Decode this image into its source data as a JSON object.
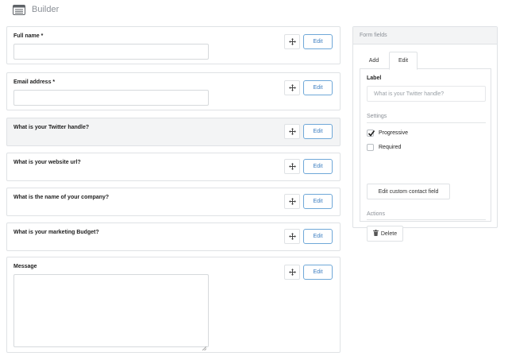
{
  "header": {
    "title": "Builder",
    "icon": "form-list-icon"
  },
  "fields": [
    {
      "label": "Full name *",
      "type": "input"
    },
    {
      "label": "Email address *",
      "type": "input"
    },
    {
      "label": "What is your Twitter handle?",
      "type": "none",
      "active": true
    },
    {
      "label": "What is your website url?",
      "type": "none"
    },
    {
      "label": "What is the name of your company?",
      "type": "none"
    },
    {
      "label": "What is your marketing Budget?",
      "type": "none"
    },
    {
      "label": "Message",
      "type": "textarea"
    }
  ],
  "field_actions": {
    "move_icon": "move-arrows-icon",
    "edit_label": "Edit"
  },
  "panel": {
    "title": "Form fields",
    "tabs": [
      {
        "label": "Add"
      },
      {
        "label": "Edit",
        "selected": true
      }
    ],
    "label_heading": "Label",
    "label_value": "What is your Twitter handle?",
    "settings_heading": "Settings",
    "progressive_label": "Progressive",
    "progressive_checked": true,
    "required_label": "Required",
    "required_checked": false,
    "custom_button": "Edit custom contact field",
    "actions_heading": "Actions",
    "delete_button": "Delete",
    "delete_icon": "trash-icon"
  },
  "colors": {
    "accent": "#3b7dc0",
    "active_row": "#f3f4f5",
    "border": "#dfe2e5"
  }
}
